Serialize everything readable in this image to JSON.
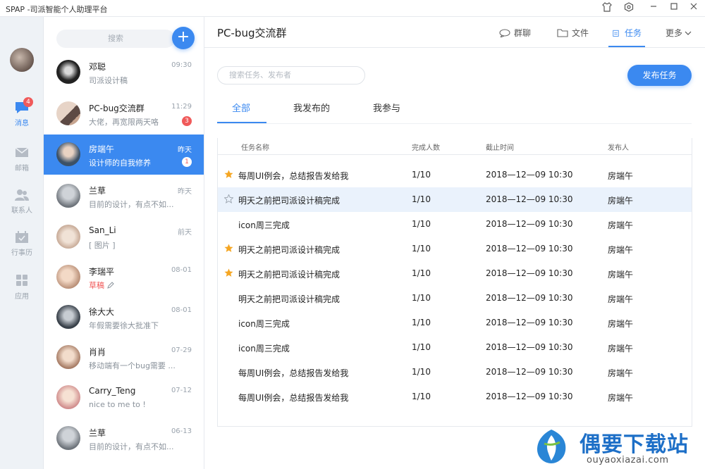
{
  "app": {
    "title": "SPAP -司派智能个人助理平台"
  },
  "rail": {
    "items": [
      {
        "label": "消息",
        "badge": "4",
        "icon": "chat-icon",
        "active": true
      },
      {
        "label": "邮箱",
        "icon": "mail-icon"
      },
      {
        "label": "联系人",
        "icon": "contacts-icon"
      },
      {
        "label": "行事历",
        "icon": "calendar-icon"
      },
      {
        "label": "应用",
        "icon": "apps-icon"
      }
    ]
  },
  "list": {
    "search_placeholder": "搜索",
    "add_label": "+",
    "conversations": [
      {
        "name": "邓聪",
        "time": "09:30",
        "message": "司派设计稿"
      },
      {
        "name": "PC-bug交流群",
        "time": "11:29",
        "message": "大佬，再宽限两天咯",
        "badge": "3"
      },
      {
        "name": "房端午",
        "time": "昨天",
        "message": "设计师的自我修养",
        "badge": "1",
        "active": true
      },
      {
        "name": "兰草",
        "time": "昨天",
        "message": "目前的设计，有点不如..."
      },
      {
        "name": "San_Li",
        "time": "前天",
        "message": "[ 图片 ]"
      },
      {
        "name": "李瑞平",
        "time": "08-01",
        "message": "草稿",
        "draft": true
      },
      {
        "name": "徐大大",
        "time": "08-01",
        "message": "年假需要徐大批准下"
      },
      {
        "name": "肖肖",
        "time": "07-29",
        "message": "移动端有一个bug需要 ..."
      },
      {
        "name": "Carry_Teng",
        "time": "07-12",
        "message": "nice to me to !"
      },
      {
        "name": "兰草",
        "time": "06-13",
        "message": "目前的设计，有点不如..."
      }
    ]
  },
  "main": {
    "group_title": "PC-bug交流群",
    "header_tabs": [
      {
        "label": "群聊",
        "icon": "chat-bubble-icon"
      },
      {
        "label": "文件",
        "icon": "folder-icon"
      },
      {
        "label": "任务",
        "icon": "task-icon",
        "active": true
      },
      {
        "label": "更多",
        "icon": "chevron-down-icon"
      }
    ],
    "task_search_placeholder": "搜索任务、发布者",
    "publish_label": "发布任务",
    "subtabs": [
      {
        "label": "全部",
        "active": true
      },
      {
        "label": "我发布的"
      },
      {
        "label": "我参与"
      }
    ],
    "columns": [
      "任务名称",
      "完成人数",
      "截止时间",
      "发布人"
    ],
    "rows": [
      {
        "star": "filled",
        "name": "每周UI例会，总结报告发给我",
        "done": "1/10",
        "deadline": "2018—12—09   10:30",
        "publisher": "房端午"
      },
      {
        "star": "outline",
        "name": "明天之前把司派设计稿完成",
        "done": "1/10",
        "deadline": "2018—12—09   10:30",
        "publisher": "房端午",
        "highlight": true
      },
      {
        "star": "none",
        "name": "icon周三完成",
        "done": "1/10",
        "deadline": "2018—12—09   10:30",
        "publisher": "房端午"
      },
      {
        "star": "filled",
        "name": "明天之前把司派设计稿完成",
        "done": "1/10",
        "deadline": "2018—12—09   10:30",
        "publisher": "房端午"
      },
      {
        "star": "filled",
        "name": "明天之前把司派设计稿完成",
        "done": "1/10",
        "deadline": "2018—12—09   10:30",
        "publisher": "房端午"
      },
      {
        "star": "none",
        "name": "明天之前把司派设计稿完成",
        "done": "1/10",
        "deadline": "2018—12—09   10:30",
        "publisher": "房端午"
      },
      {
        "star": "none",
        "name": "icon周三完成",
        "done": "1/10",
        "deadline": "2018—12—09   10:30",
        "publisher": "房端午"
      },
      {
        "star": "none",
        "name": "icon周三完成",
        "done": "1/10",
        "deadline": "2018—12—09   10:30",
        "publisher": "房端午"
      },
      {
        "star": "none",
        "name": "每周UI例会，总结报告发给我",
        "done": "1/10",
        "deadline": "2018—12—09   10:30",
        "publisher": "房端午"
      },
      {
        "star": "none",
        "name": "每周UI例会，总结报告发给我",
        "done": "1/10",
        "deadline": "2018—12—09   10:30",
        "publisher": "房端午"
      }
    ]
  },
  "watermark": {
    "title": "偶要下载站",
    "subtitle": "ouyaoxiazai.com"
  },
  "colors": {
    "accent": "#3b89f0",
    "badge": "#f05a5a",
    "star": "#f5a623"
  }
}
